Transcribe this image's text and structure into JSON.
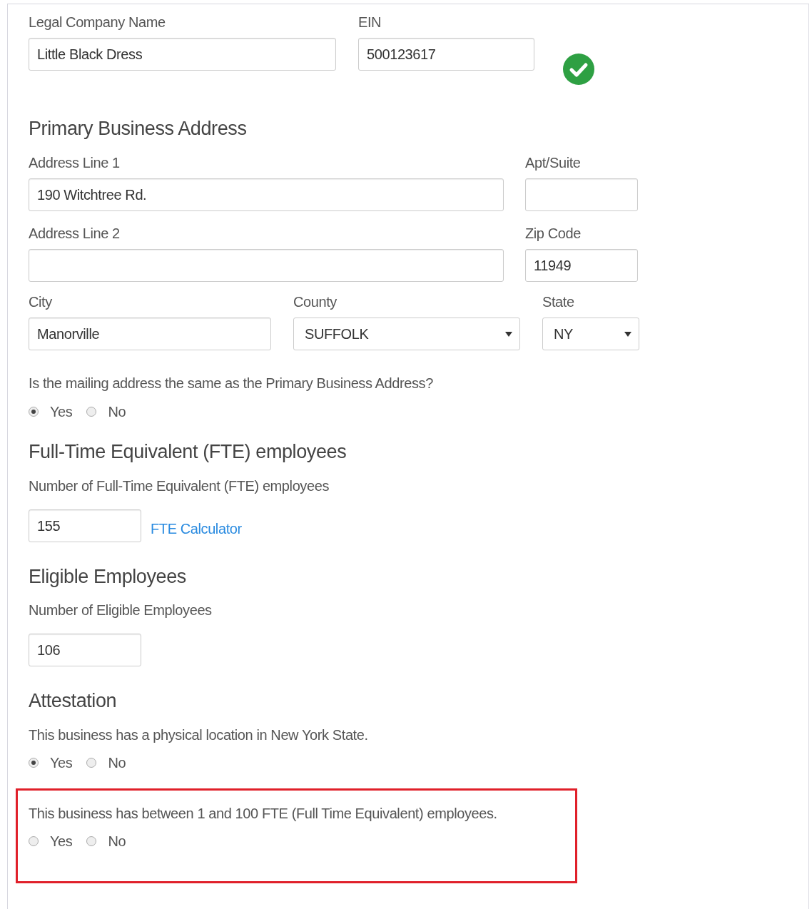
{
  "company": {
    "name": {
      "label": "Legal Company Name",
      "value": "Little Black Dress"
    },
    "ein": {
      "label": "EIN",
      "value": "500123617",
      "verified": true
    }
  },
  "address": {
    "heading": "Primary Business Address",
    "line1": {
      "label": "Address Line 1",
      "value": "190 Witchtree Rd."
    },
    "apt": {
      "label": "Apt/Suite"
    },
    "line2": {
      "label": "Address Line 2"
    },
    "zip": {
      "label": "Zip Code",
      "value": "11949"
    },
    "city": {
      "label": "City",
      "value": "Manorville"
    },
    "county": {
      "label": "County",
      "value": "SUFFOLK"
    },
    "state": {
      "label": "State",
      "value": "NY"
    }
  },
  "mailing": {
    "question": "Is the mailing address the same as the Primary Business Address?",
    "options": [
      {
        "label": "Yes",
        "selected": true
      },
      {
        "label": "No",
        "selected": false
      }
    ]
  },
  "fte": {
    "heading": "Full-Time Equivalent (FTE) employees",
    "label": "Number of Full-Time Equivalent (FTE) employees",
    "value": "155",
    "link": "FTE Calculator"
  },
  "eligible": {
    "heading": "Eligible Employees",
    "label": "Number of Eligible Employees",
    "value": "106"
  },
  "attestation": {
    "heading": "Attestation",
    "questions": [
      {
        "text": "This business has a physical location in New York State.",
        "highlighted": false,
        "options": [
          {
            "label": "Yes",
            "selected": true
          },
          {
            "label": "No",
            "selected": false
          }
        ]
      },
      {
        "text": "This business has between 1 and 100 FTE (Full Time Equivalent) employees.",
        "highlighted": true,
        "options": [
          {
            "label": "Yes",
            "selected": false
          },
          {
            "label": "No",
            "selected": false
          }
        ]
      }
    ]
  }
}
